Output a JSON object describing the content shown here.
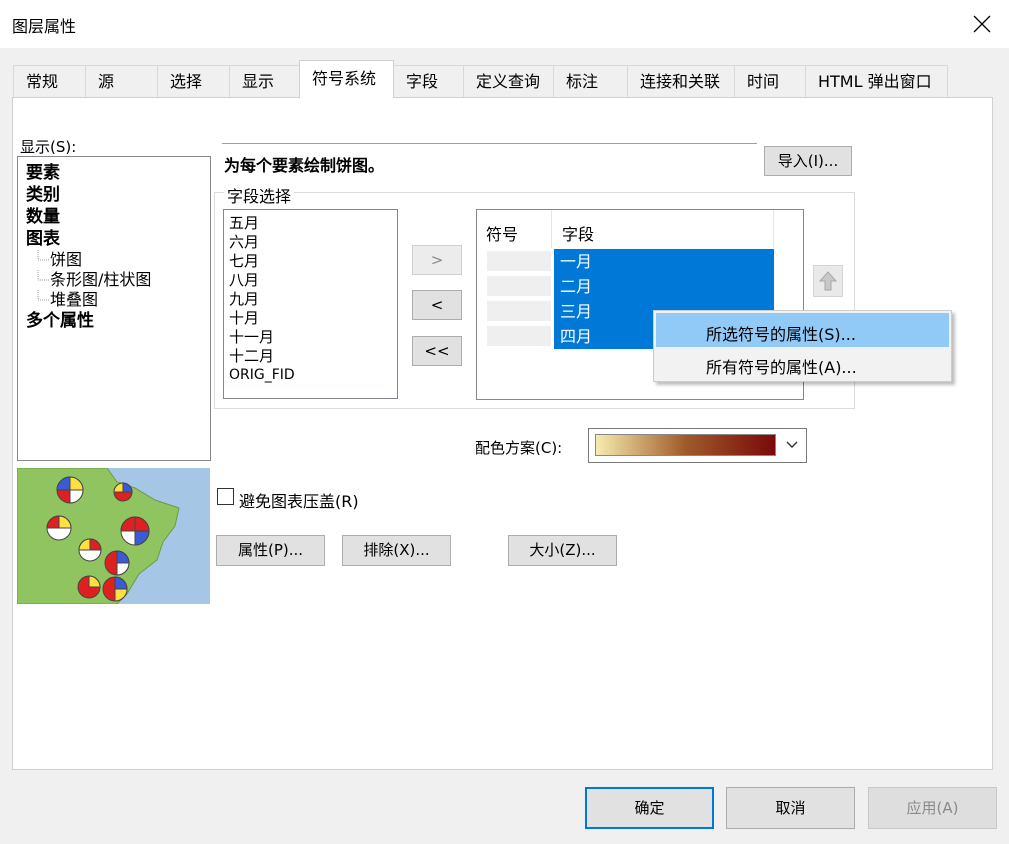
{
  "window": {
    "title": "图层属性"
  },
  "tabs": [
    "常规",
    "源",
    "选择",
    "显示",
    "符号系统",
    "字段",
    "定义查询",
    "标注",
    "连接和关联",
    "时间",
    "HTML 弹出窗口"
  ],
  "show": {
    "label": "显示(S):",
    "items": [
      "要素",
      "类别",
      "数量",
      "图表"
    ],
    "chart_children": [
      "饼图",
      "条形图/柱状图",
      "堆叠图"
    ],
    "last_item": "多个属性"
  },
  "description": "为每个要素绘制饼图。",
  "import_button": "导入(I)...",
  "field_selection": {
    "legend": "字段选择",
    "available_fields": [
      "五月",
      "六月",
      "七月",
      "八月",
      "九月",
      "十月",
      "十一月",
      "十二月",
      "ORIG_FID"
    ],
    "move_buttons": [
      ">",
      "<",
      "<<"
    ],
    "selected_table": {
      "headers": [
        "符号",
        "字段"
      ],
      "rows": [
        "一月",
        "二月",
        "三月",
        "四月"
      ]
    }
  },
  "context_menu": {
    "items": [
      "所选符号的属性(S)...",
      "所有符号的属性(A)..."
    ]
  },
  "color_scheme": {
    "label": "配色方案(C):",
    "gradient_colors": [
      "#f6ecb0",
      "#a05a2a",
      "#7a0a0a"
    ]
  },
  "avoid_overlap": {
    "label": "避免图表压盖(R)",
    "checked": false
  },
  "bottom_buttons": {
    "properties": "属性(P)...",
    "exclude": "排除(X)...",
    "size": "大小(Z)..."
  },
  "dialog_buttons": {
    "ok": "确定",
    "cancel": "取消",
    "apply": "应用(A)"
  },
  "colors": {
    "selection": "#0078d7",
    "menu_highlight": "#91c9f7",
    "map_water": "#a6c6e6",
    "map_land": "#8fc460"
  }
}
